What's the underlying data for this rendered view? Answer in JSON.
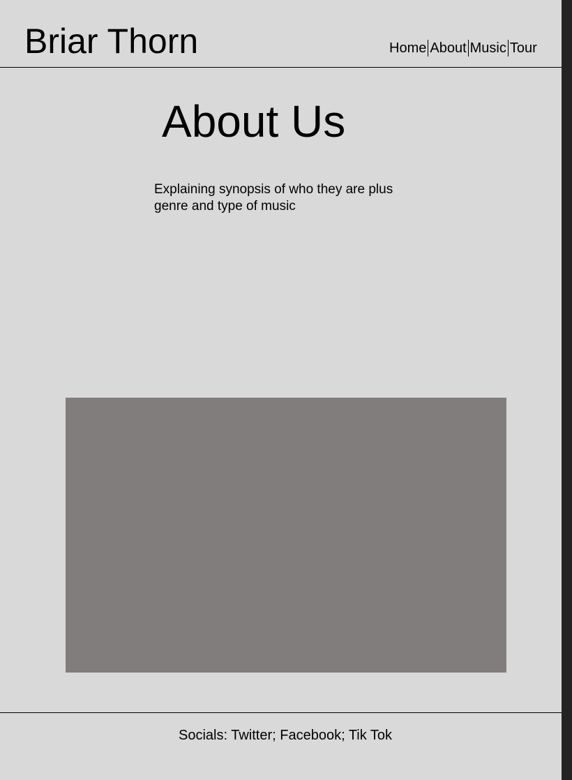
{
  "header": {
    "site_title": "Briar Thorn",
    "nav": {
      "home": "Home",
      "about": "About",
      "music": "Music",
      "tour": "Tour"
    }
  },
  "main": {
    "title": "About Us",
    "synopsis": "Explaining synopsis of who they are plus genre and type of music"
  },
  "footer": {
    "socials": "Socials: Twitter; Facebook; Tik Tok"
  },
  "colors": {
    "background": "#d9d9d9",
    "image_placeholder": "#827d7d",
    "scrollbar": "#232323"
  }
}
